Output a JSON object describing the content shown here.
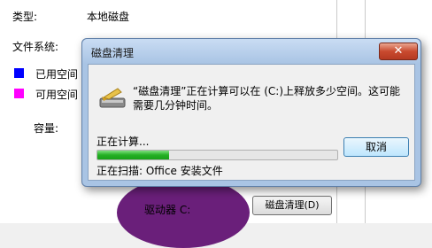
{
  "properties": {
    "type_label": "类型:",
    "type_value": "本地磁盘",
    "fs_label": "文件系统:",
    "used_label": "已用空间",
    "free_label": "可用空间",
    "capacity_label": "容量:",
    "drive_label": "驱动器 C:",
    "cleanup_button": "磁盘清理(D)",
    "used_color": "#0000ff",
    "free_color": "#ff00ff"
  },
  "dialog": {
    "title": "磁盘清理",
    "close_icon": "close-x",
    "message": "“磁盘清理”正在计算可以在 (C:)上释放多少空间。这可能需要几分钟时间。",
    "calculating": "正在计算...",
    "progress": 0.3,
    "cancel_button": "取消",
    "scanning": "正在扫描:  Office 安装文件",
    "icon": "disk-cleanup-icon"
  }
}
